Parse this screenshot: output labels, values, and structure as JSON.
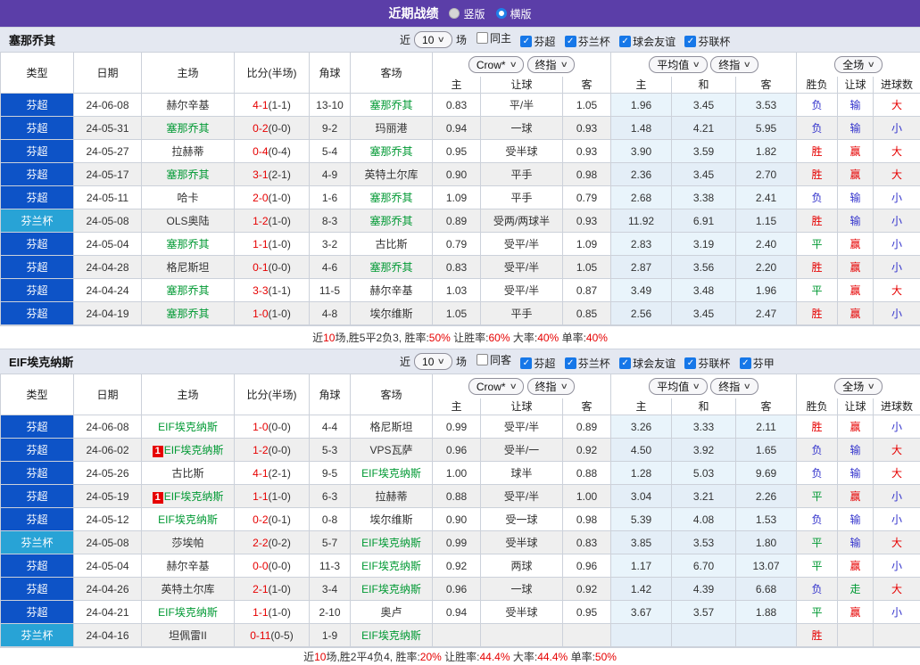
{
  "titlebar": {
    "title": "近期战绩",
    "vertical_label": "竖版",
    "horizontal_label": "横版",
    "selected_layout": "横版"
  },
  "controls": {
    "near_label": "近",
    "games_label": "场"
  },
  "table_controls": {
    "crow": "Crow*",
    "final1": "终指",
    "avg": "平均值",
    "final2": "终指",
    "full": "全场"
  },
  "columns": {
    "type": "类型",
    "date": "日期",
    "home": "主场",
    "score": "比分(半场)",
    "corner": "角球",
    "away": "客场",
    "odds_home": "主",
    "odds_handicap": "让球",
    "odds_away": "客",
    "avg_home": "主",
    "avg_draw": "和",
    "avg_away": "客",
    "res_wdl": "胜负",
    "res_handicap": "让球",
    "res_goals": "进球数"
  },
  "colors": {
    "titlebar_bg": "#5b3ea8",
    "league_badge": {
      "芬超": "#0d53c7",
      "芬兰杯": "#28a3d6"
    },
    "self_team": "#009933",
    "score": "#e60000",
    "result": {
      "胜": "#e60000",
      "赢": "#e60000",
      "大": "#e60000",
      "平": "#009933",
      "走": "#009933",
      "负": "#3333cc",
      "输": "#3333cc",
      "小": "#3333cc"
    },
    "summary_red": "#e60000",
    "checkbox_blue": "#1677e8",
    "avg_col_bg": "#e9f4fb"
  },
  "sections": [
    {
      "team": "塞那乔其",
      "near_value": "10",
      "filters": [
        {
          "label": "同主",
          "checked": false
        },
        {
          "label": "芬超",
          "checked": true
        },
        {
          "label": "芬兰杯",
          "checked": true
        },
        {
          "label": "球会友谊",
          "checked": true
        },
        {
          "label": "芬联杯",
          "checked": true
        }
      ],
      "rows": [
        {
          "type": "芬超",
          "date": "24-06-08",
          "home": "赫尔辛基",
          "home_self": false,
          "badge": "",
          "ft": "4-1",
          "ht": "1-1",
          "corner": "13-10",
          "away": "塞那乔其",
          "away_self": true,
          "o1": "0.83",
          "let": "平/半",
          "o2": "1.05",
          "a1": "1.96",
          "a2": "3.45",
          "a3": "3.53",
          "r1": "负",
          "r2": "输",
          "r3": "大"
        },
        {
          "type": "芬超",
          "date": "24-05-31",
          "home": "塞那乔其",
          "home_self": true,
          "badge": "",
          "ft": "0-2",
          "ht": "0-0",
          "corner": "9-2",
          "away": "玛丽港",
          "away_self": false,
          "o1": "0.94",
          "let": "一球",
          "o2": "0.93",
          "a1": "1.48",
          "a2": "4.21",
          "a3": "5.95",
          "r1": "负",
          "r2": "输",
          "r3": "小"
        },
        {
          "type": "芬超",
          "date": "24-05-27",
          "home": "拉赫蒂",
          "home_self": false,
          "badge": "",
          "ft": "0-4",
          "ht": "0-4",
          "corner": "5-4",
          "away": "塞那乔其",
          "away_self": true,
          "o1": "0.95",
          "let": "受半球",
          "o2": "0.93",
          "a1": "3.90",
          "a2": "3.59",
          "a3": "1.82",
          "r1": "胜",
          "r2": "赢",
          "r3": "大"
        },
        {
          "type": "芬超",
          "date": "24-05-17",
          "home": "塞那乔其",
          "home_self": true,
          "badge": "",
          "ft": "3-1",
          "ht": "2-1",
          "corner": "4-9",
          "away": "英特土尔库",
          "away_self": false,
          "o1": "0.90",
          "let": "平手",
          "o2": "0.98",
          "a1": "2.36",
          "a2": "3.45",
          "a3": "2.70",
          "r1": "胜",
          "r2": "赢",
          "r3": "大"
        },
        {
          "type": "芬超",
          "date": "24-05-11",
          "home": "哈卡",
          "home_self": false,
          "badge": "",
          "ft": "2-0",
          "ht": "1-0",
          "corner": "1-6",
          "away": "塞那乔其",
          "away_self": true,
          "o1": "1.09",
          "let": "平手",
          "o2": "0.79",
          "a1": "2.68",
          "a2": "3.38",
          "a3": "2.41",
          "r1": "负",
          "r2": "输",
          "r3": "小"
        },
        {
          "type": "芬兰杯",
          "date": "24-05-08",
          "home": "OLS奥陆",
          "home_self": false,
          "badge": "",
          "ft": "1-2",
          "ht": "1-0",
          "corner": "8-3",
          "away": "塞那乔其",
          "away_self": true,
          "o1": "0.89",
          "let": "受两/两球半",
          "o2": "0.93",
          "a1": "11.92",
          "a2": "6.91",
          "a3": "1.15",
          "r1": "胜",
          "r2": "输",
          "r3": "小"
        },
        {
          "type": "芬超",
          "date": "24-05-04",
          "home": "塞那乔其",
          "home_self": true,
          "badge": "",
          "ft": "1-1",
          "ht": "1-0",
          "corner": "3-2",
          "away": "古比斯",
          "away_self": false,
          "o1": "0.79",
          "let": "受平/半",
          "o2": "1.09",
          "a1": "2.83",
          "a2": "3.19",
          "a3": "2.40",
          "r1": "平",
          "r2": "赢",
          "r3": "小"
        },
        {
          "type": "芬超",
          "date": "24-04-28",
          "home": "格尼斯坦",
          "home_self": false,
          "badge": "",
          "ft": "0-1",
          "ht": "0-0",
          "corner": "4-6",
          "away": "塞那乔其",
          "away_self": true,
          "o1": "0.83",
          "let": "受平/半",
          "o2": "1.05",
          "a1": "2.87",
          "a2": "3.56",
          "a3": "2.20",
          "r1": "胜",
          "r2": "赢",
          "r3": "小"
        },
        {
          "type": "芬超",
          "date": "24-04-24",
          "home": "塞那乔其",
          "home_self": true,
          "badge": "",
          "ft": "3-3",
          "ht": "1-1",
          "corner": "11-5",
          "away": "赫尔辛基",
          "away_self": false,
          "o1": "1.03",
          "let": "受平/半",
          "o2": "0.87",
          "a1": "3.49",
          "a2": "3.48",
          "a3": "1.96",
          "r1": "平",
          "r2": "赢",
          "r3": "大"
        },
        {
          "type": "芬超",
          "date": "24-04-19",
          "home": "塞那乔其",
          "home_self": true,
          "badge": "",
          "ft": "1-0",
          "ht": "1-0",
          "corner": "4-8",
          "away": "埃尔维斯",
          "away_self": false,
          "o1": "1.05",
          "let": "平手",
          "o2": "0.85",
          "a1": "2.56",
          "a2": "3.45",
          "a3": "2.47",
          "r1": "胜",
          "r2": "赢",
          "r3": "小"
        }
      ],
      "summary": [
        {
          "t": "近",
          "c": "k"
        },
        {
          "t": "10",
          "c": "r"
        },
        {
          "t": "场,胜5平2负3, 胜率:",
          "c": "k"
        },
        {
          "t": "50%",
          "c": "r"
        },
        {
          "t": " 让胜率:",
          "c": "k"
        },
        {
          "t": "60%",
          "c": "r"
        },
        {
          "t": " 大率:",
          "c": "k"
        },
        {
          "t": "40%",
          "c": "r"
        },
        {
          "t": " 单率:",
          "c": "k"
        },
        {
          "t": "40%",
          "c": "r"
        }
      ]
    },
    {
      "team": "EIF埃克纳斯",
      "near_value": "10",
      "filters": [
        {
          "label": "同客",
          "checked": false
        },
        {
          "label": "芬超",
          "checked": true
        },
        {
          "label": "芬兰杯",
          "checked": true
        },
        {
          "label": "球会友谊",
          "checked": true
        },
        {
          "label": "芬联杯",
          "checked": true
        },
        {
          "label": "芬甲",
          "checked": true
        }
      ],
      "rows": [
        {
          "type": "芬超",
          "date": "24-06-08",
          "home": "EIF埃克纳斯",
          "home_self": true,
          "badge": "",
          "ft": "1-0",
          "ht": "0-0",
          "corner": "4-4",
          "away": "格尼斯坦",
          "away_self": false,
          "o1": "0.99",
          "let": "受平/半",
          "o2": "0.89",
          "a1": "3.26",
          "a2": "3.33",
          "a3": "2.11",
          "r1": "胜",
          "r2": "赢",
          "r3": "小"
        },
        {
          "type": "芬超",
          "date": "24-06-02",
          "home": "EIF埃克纳斯",
          "home_self": true,
          "badge": "1",
          "ft": "1-2",
          "ht": "0-0",
          "corner": "5-3",
          "away": "VPS瓦萨",
          "away_self": false,
          "o1": "0.96",
          "let": "受半/一",
          "o2": "0.92",
          "a1": "4.50",
          "a2": "3.92",
          "a3": "1.65",
          "r1": "负",
          "r2": "输",
          "r3": "大"
        },
        {
          "type": "芬超",
          "date": "24-05-26",
          "home": "古比斯",
          "home_self": false,
          "badge": "",
          "ft": "4-1",
          "ht": "2-1",
          "corner": "9-5",
          "away": "EIF埃克纳斯",
          "away_self": true,
          "o1": "1.00",
          "let": "球半",
          "o2": "0.88",
          "a1": "1.28",
          "a2": "5.03",
          "a3": "9.69",
          "r1": "负",
          "r2": "输",
          "r3": "大"
        },
        {
          "type": "芬超",
          "date": "24-05-19",
          "home": "EIF埃克纳斯",
          "home_self": true,
          "badge": "1",
          "ft": "1-1",
          "ht": "1-0",
          "corner": "6-3",
          "away": "拉赫蒂",
          "away_self": false,
          "o1": "0.88",
          "let": "受平/半",
          "o2": "1.00",
          "a1": "3.04",
          "a2": "3.21",
          "a3": "2.26",
          "r1": "平",
          "r2": "赢",
          "r3": "小"
        },
        {
          "type": "芬超",
          "date": "24-05-12",
          "home": "EIF埃克纳斯",
          "home_self": true,
          "badge": "",
          "ft": "0-2",
          "ht": "0-1",
          "corner": "0-8",
          "away": "埃尔维斯",
          "away_self": false,
          "o1": "0.90",
          "let": "受一球",
          "o2": "0.98",
          "a1": "5.39",
          "a2": "4.08",
          "a3": "1.53",
          "r1": "负",
          "r2": "输",
          "r3": "小"
        },
        {
          "type": "芬兰杯",
          "date": "24-05-08",
          "home": "莎埃帕",
          "home_self": false,
          "badge": "",
          "ft": "2-2",
          "ht": "0-2",
          "corner": "5-7",
          "away": "EIF埃克纳斯",
          "away_self": true,
          "o1": "0.99",
          "let": "受半球",
          "o2": "0.83",
          "a1": "3.85",
          "a2": "3.53",
          "a3": "1.80",
          "r1": "平",
          "r2": "输",
          "r3": "大"
        },
        {
          "type": "芬超",
          "date": "24-05-04",
          "home": "赫尔辛基",
          "home_self": false,
          "badge": "",
          "ft": "0-0",
          "ht": "0-0",
          "corner": "11-3",
          "away": "EIF埃克纳斯",
          "away_self": true,
          "o1": "0.92",
          "let": "两球",
          "o2": "0.96",
          "a1": "1.17",
          "a2": "6.70",
          "a3": "13.07",
          "r1": "平",
          "r2": "赢",
          "r3": "小"
        },
        {
          "type": "芬超",
          "date": "24-04-26",
          "home": "英特土尔库",
          "home_self": false,
          "badge": "",
          "ft": "2-1",
          "ht": "1-0",
          "corner": "3-4",
          "away": "EIF埃克纳斯",
          "away_self": true,
          "o1": "0.96",
          "let": "一球",
          "o2": "0.92",
          "a1": "1.42",
          "a2": "4.39",
          "a3": "6.68",
          "r1": "负",
          "r2": "走",
          "r3": "大"
        },
        {
          "type": "芬超",
          "date": "24-04-21",
          "home": "EIF埃克纳斯",
          "home_self": true,
          "badge": "",
          "ft": "1-1",
          "ht": "1-0",
          "corner": "2-10",
          "away": "奥卢",
          "away_self": false,
          "o1": "0.94",
          "let": "受半球",
          "o2": "0.95",
          "a1": "3.67",
          "a2": "3.57",
          "a3": "1.88",
          "r1": "平",
          "r2": "赢",
          "r3": "小"
        },
        {
          "type": "芬兰杯",
          "date": "24-04-16",
          "home": "坦佩雷II",
          "home_self": false,
          "badge": "",
          "ft": "0-11",
          "ht": "0-5",
          "corner": "1-9",
          "away": "EIF埃克纳斯",
          "away_self": true,
          "o1": "",
          "let": "",
          "o2": "",
          "a1": "",
          "a2": "",
          "a3": "",
          "r1": "胜",
          "r2": "",
          "r3": ""
        }
      ],
      "summary": [
        {
          "t": "近",
          "c": "k"
        },
        {
          "t": "10",
          "c": "r"
        },
        {
          "t": "场,胜2平4负4, 胜率:",
          "c": "k"
        },
        {
          "t": "20%",
          "c": "r"
        },
        {
          "t": " 让胜率:",
          "c": "k"
        },
        {
          "t": "44.4%",
          "c": "r"
        },
        {
          "t": " 大率:",
          "c": "k"
        },
        {
          "t": "44.4%",
          "c": "r"
        },
        {
          "t": " 单率:",
          "c": "k"
        },
        {
          "t": "50%",
          "c": "r"
        }
      ]
    }
  ]
}
